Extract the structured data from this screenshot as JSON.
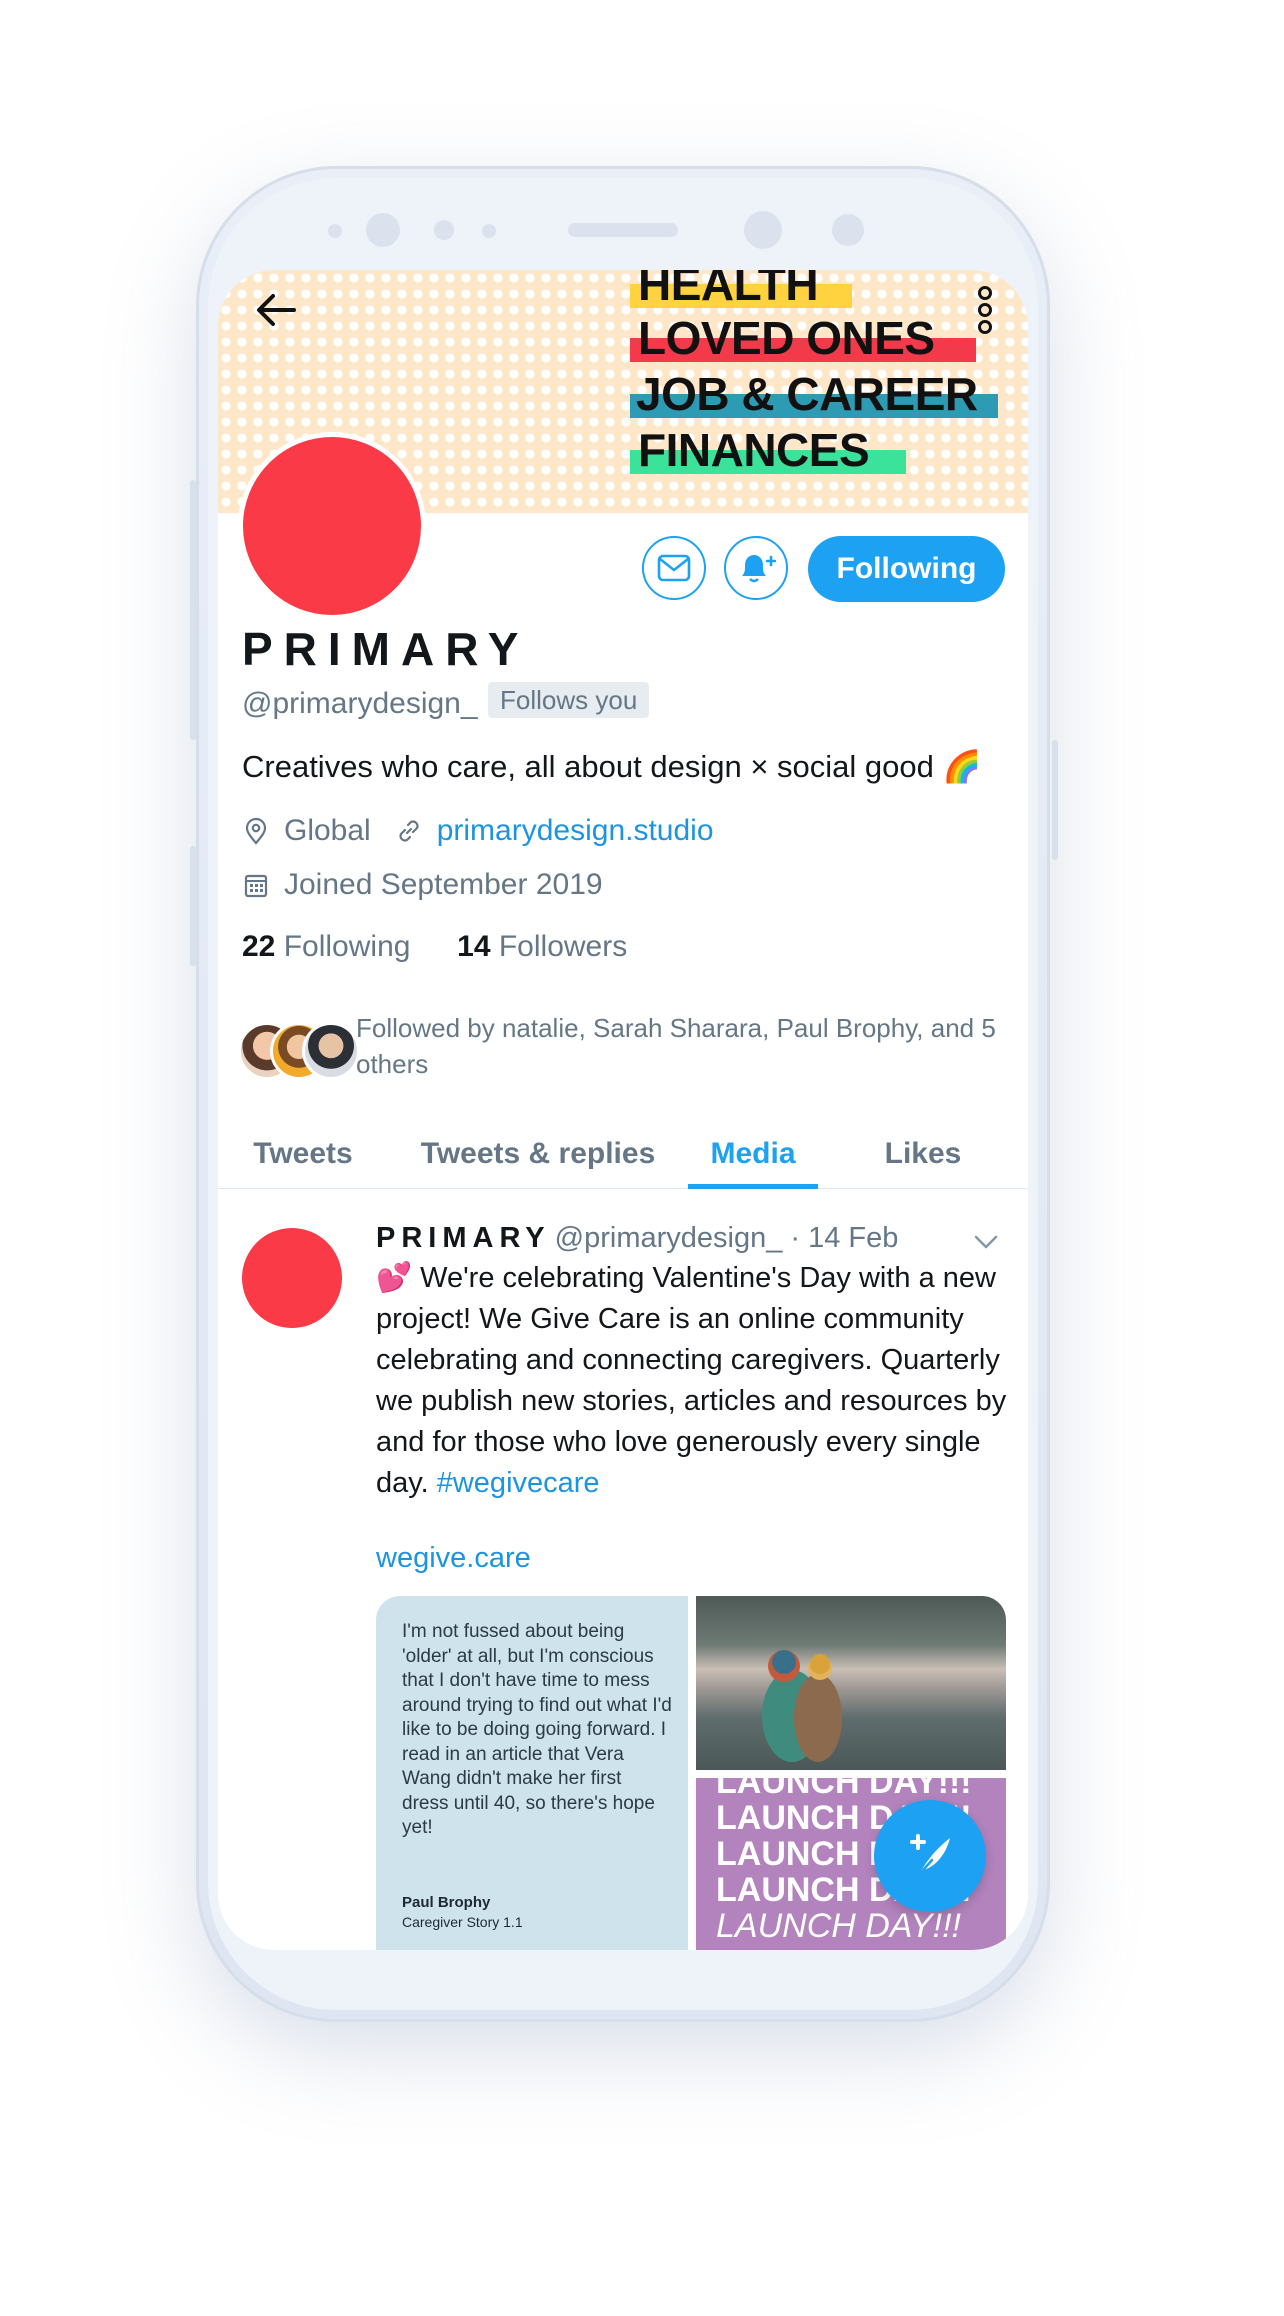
{
  "banner": {
    "lines": [
      "HEALTH",
      "LOVED ONES",
      "JOB & CAREER",
      "FINANCES"
    ],
    "highlight_colors": [
      "#ffd23f",
      "#f23a4b",
      "#2e9bb5",
      "#3be39a"
    ]
  },
  "profile": {
    "display_name": "PRIMARY",
    "handle": "@primarydesign_",
    "follows_you": "Follows you",
    "bio": "Creatives who care, all about design × social good 🌈",
    "location": "Global",
    "website": "primarydesign.studio",
    "joined": "Joined September 2019",
    "following_count": "22",
    "following_label": "Following",
    "followers_count": "14",
    "followers_label": "Followers",
    "followed_by": "Followed by natalie, Sarah Sharara, Paul Brophy, and 5 others",
    "avatar_color": "#fb3a47"
  },
  "actions": {
    "following_button": "Following"
  },
  "tabs": [
    {
      "label": "Tweets"
    },
    {
      "label": "Tweets & replies"
    },
    {
      "label": "Media"
    },
    {
      "label": "Likes"
    }
  ],
  "active_tab": "Media",
  "tweet": {
    "name": "PRIMARY",
    "meta": "@primarydesign_ · 14 Feb",
    "emoji": "💕",
    "text": "We're celebrating Valentine's Day with a new project! We Give Care is an online community celebrating and connecting caregivers. Quarterly we publish new stories, articles and resources by and for those who love generously every single day.",
    "hashtag": "#wegivecare",
    "link": "wegive.care",
    "media": {
      "quote": "I'm not fussed about being 'older' at all, but I'm conscious that I don't have time to mess around trying to find out what I'd like to be doing going forward. I read in an article that Vera Wang didn't make her first dress until 40, so there's hope yet!",
      "quote_author": "Paul Brophy",
      "quote_source": "Caregiver Story 1.1",
      "launch_lines": [
        "LAUNCH DAY!!!",
        "LAUNCH DAY!!!",
        "LAUNCH DAY!!!",
        "LAUNCH DAY!!!",
        "LAUNCH DAY!!!"
      ]
    }
  },
  "colors": {
    "accent": "#1da1f2",
    "link": "#1b95e0",
    "muted": "#657786",
    "banner_bg": "#fde7c8",
    "launch_bg": "#b283bd"
  },
  "icons": {
    "back": "arrow-left-icon",
    "more": "vertical-dots-icon",
    "message": "envelope-icon",
    "notifications": "bell-plus-icon",
    "location": "map-pin-icon",
    "website": "link-icon",
    "joined": "calendar-icon",
    "caret": "chevron-down-icon",
    "compose": "feather-plus-icon"
  }
}
